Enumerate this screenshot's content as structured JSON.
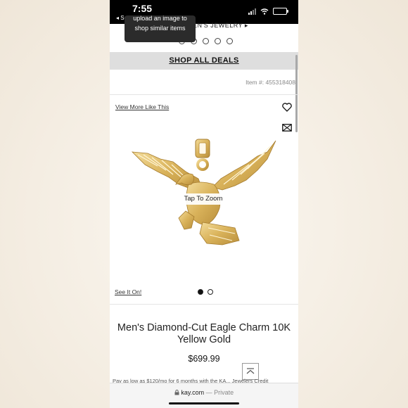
{
  "status": {
    "time": "7:55",
    "back_label": "◂ Search"
  },
  "nav": {
    "crumb": "EN'S JEWELRY ▸"
  },
  "tooltip": {
    "line1": "upload an image to",
    "line2": "shop similar items"
  },
  "deals": {
    "label": "SHOP ALL DEALS"
  },
  "product": {
    "item_number": "Item #: 455318408",
    "view_more": "View More Like This",
    "zoom_label": "Tap To Zoom",
    "see_it_on": "See It On!",
    "title": "Men's Diamond-Cut Eagle Charm 10K Yellow Gold",
    "price": "$699.99",
    "pay_note": "Pay as low as $120/mo for 6 months with the KA... Jewelers Credit"
  },
  "image_dots": {
    "count": 2,
    "active": 1
  },
  "browser": {
    "url": "kay.com",
    "privacy": "— Private"
  },
  "colors": {
    "gold": "#d9b25a",
    "deals_bg": "#dedede",
    "tooltip_bg": "#2b2b2b"
  },
  "icons": [
    "heart-icon",
    "mail-icon",
    "back-to-top-icon",
    "lock-icon",
    "wifi-icon",
    "battery-icon",
    "signal-icon"
  ]
}
